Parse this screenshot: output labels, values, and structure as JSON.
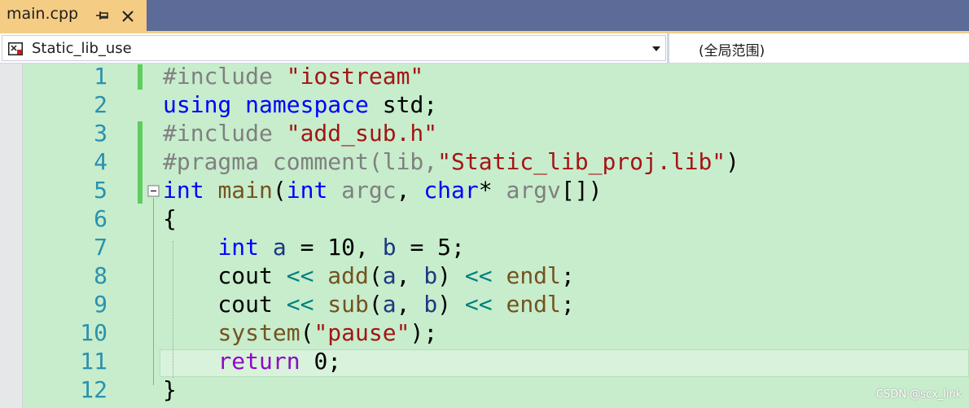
{
  "tab": {
    "title": "main.cpp",
    "active_color": "#f5cc84",
    "bar_color": "#5d6b99",
    "pin_icon": "pin-icon",
    "close_icon": "close-icon"
  },
  "navbar": {
    "project": "Static_lib_use",
    "scope": "(全局范围)",
    "project_icon": "project-icon",
    "dropdown_icon": "chevron-down-icon"
  },
  "editor": {
    "background": "#c7edcc",
    "current_line": 11,
    "line_numbers": [
      "1",
      "2",
      "3",
      "4",
      "5",
      "6",
      "7",
      "8",
      "9",
      "10",
      "11",
      "12"
    ],
    "lines": [
      [
        {
          "t": "#include ",
          "c": "pre"
        },
        {
          "t": "\"iostream\"",
          "c": "str"
        }
      ],
      [
        {
          "t": "using",
          "c": "kw"
        },
        {
          "t": " ",
          "c": "plain"
        },
        {
          "t": "namespace",
          "c": "kw"
        },
        {
          "t": " std;",
          "c": "plain"
        }
      ],
      [
        {
          "t": "#include ",
          "c": "pre"
        },
        {
          "t": "\"add_sub.h\"",
          "c": "str"
        }
      ],
      [
        {
          "t": "#pragma comment(lib,",
          "c": "pre"
        },
        {
          "t": "\"Static_lib_proj.lib\"",
          "c": "str"
        },
        {
          "t": ")",
          "c": "plain"
        }
      ],
      [
        {
          "t": "int",
          "c": "kw"
        },
        {
          "t": " ",
          "c": "plain"
        },
        {
          "t": "main",
          "c": "fn"
        },
        {
          "t": "(",
          "c": "plain"
        },
        {
          "t": "int",
          "c": "kw"
        },
        {
          "t": " ",
          "c": "plain"
        },
        {
          "t": "argc",
          "c": "par"
        },
        {
          "t": ", ",
          "c": "plain"
        },
        {
          "t": "char",
          "c": "kw"
        },
        {
          "t": "* ",
          "c": "plain"
        },
        {
          "t": "argv",
          "c": "par"
        },
        {
          "t": "[])",
          "c": "plain"
        }
      ],
      [
        {
          "t": "{",
          "c": "plain"
        }
      ],
      [
        {
          "t": "    ",
          "c": "plain"
        },
        {
          "t": "int",
          "c": "kw"
        },
        {
          "t": " ",
          "c": "plain"
        },
        {
          "t": "a",
          "c": "var"
        },
        {
          "t": " = 10, ",
          "c": "plain"
        },
        {
          "t": "b",
          "c": "var"
        },
        {
          "t": " = 5;",
          "c": "plain"
        }
      ],
      [
        {
          "t": "    cout ",
          "c": "plain"
        },
        {
          "t": "<<",
          "c": "op"
        },
        {
          "t": " ",
          "c": "plain"
        },
        {
          "t": "add",
          "c": "fn"
        },
        {
          "t": "(",
          "c": "plain"
        },
        {
          "t": "a",
          "c": "var"
        },
        {
          "t": ", ",
          "c": "plain"
        },
        {
          "t": "b",
          "c": "var"
        },
        {
          "t": ") ",
          "c": "plain"
        },
        {
          "t": "<<",
          "c": "op"
        },
        {
          "t": " ",
          "c": "plain"
        },
        {
          "t": "endl",
          "c": "fn"
        },
        {
          "t": ";",
          "c": "plain"
        }
      ],
      [
        {
          "t": "    cout ",
          "c": "plain"
        },
        {
          "t": "<<",
          "c": "op"
        },
        {
          "t": " ",
          "c": "plain"
        },
        {
          "t": "sub",
          "c": "fn"
        },
        {
          "t": "(",
          "c": "plain"
        },
        {
          "t": "a",
          "c": "var"
        },
        {
          "t": ", ",
          "c": "plain"
        },
        {
          "t": "b",
          "c": "var"
        },
        {
          "t": ") ",
          "c": "plain"
        },
        {
          "t": "<<",
          "c": "op"
        },
        {
          "t": " ",
          "c": "plain"
        },
        {
          "t": "endl",
          "c": "fn"
        },
        {
          "t": ";",
          "c": "plain"
        }
      ],
      [
        {
          "t": "    ",
          "c": "plain"
        },
        {
          "t": "system",
          "c": "fn"
        },
        {
          "t": "(",
          "c": "plain"
        },
        {
          "t": "\"pause\"",
          "c": "str"
        },
        {
          "t": ");",
          "c": "plain"
        }
      ],
      [
        {
          "t": "    ",
          "c": "plain"
        },
        {
          "t": "return",
          "c": "ctl"
        },
        {
          "t": " 0;",
          "c": "plain"
        }
      ],
      [
        {
          "t": "}",
          "c": "plain"
        }
      ]
    ],
    "changed_lines": [
      1,
      3,
      4,
      5
    ],
    "fold_icon": "collapse-icon"
  },
  "watermark": "CSDN @scx_link"
}
